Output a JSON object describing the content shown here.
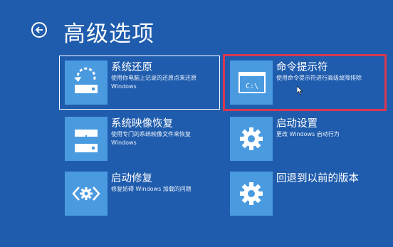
{
  "header": {
    "title": "高级选项"
  },
  "tiles": [
    {
      "title": "系统还原",
      "desc": "使用你电脑上记录的还原点来还原 Windows",
      "icon": "system-restore-icon"
    },
    {
      "title": "命令提示符",
      "desc": "使用命令提示符进行高级故障排除",
      "icon": "command-prompt-icon",
      "icon_text": "C:\\"
    },
    {
      "title": "系统映像恢复",
      "desc": "使用专门的系统映像文件来恢复 Windows",
      "icon": "system-image-icon"
    },
    {
      "title": "启动设置",
      "desc": "更改 Windows 启动行为",
      "icon": "gear-icon"
    },
    {
      "title": "启动修复",
      "desc": "修复妨碍 Windows 加载的问题",
      "icon": "startup-repair-icon"
    },
    {
      "title": "回退到以前的版本",
      "desc": "",
      "icon": "gear-icon"
    }
  ],
  "colors": {
    "background": "#1f5cad",
    "tile_icon_bg": "#4a9ae0",
    "highlight": "#d9374f"
  }
}
